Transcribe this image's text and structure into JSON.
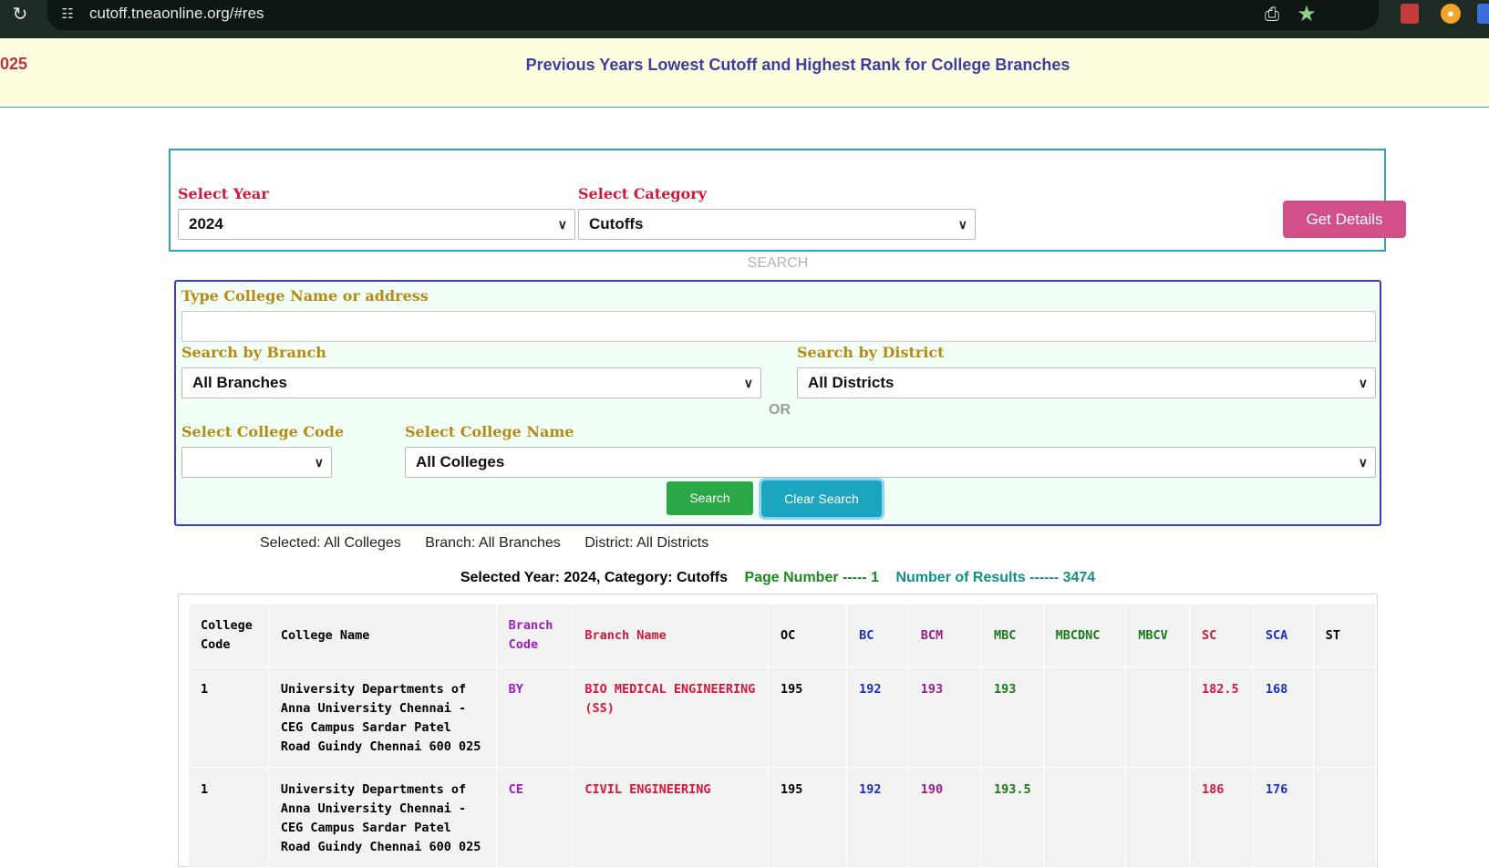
{
  "browser": {
    "url": "cutoff.tneaonline.org/#res"
  },
  "banner": {
    "left_text": "025",
    "title": "Previous Years Lowest Cutoff and Highest Rank for College Branches"
  },
  "filters": {
    "year_label": "Select Year",
    "year_value": "2024",
    "category_label": "Select Category",
    "category_value": "Cutoffs",
    "get_details": "Get Details"
  },
  "search": {
    "caption": "SEARCH",
    "college_text_label": "Type College Name or address",
    "college_text_value": "",
    "branch_label": "Search by Branch",
    "branch_value": "All Branches",
    "district_label": "Search by District",
    "district_value": "All Districts",
    "or_text": "OR",
    "code_label": "Select College Code",
    "code_value": "",
    "name_label": "Select College Name",
    "name_value": "All Colleges",
    "search_button": "Search",
    "clear_button": "Clear Search"
  },
  "selection": {
    "college": "Selected: All Colleges",
    "branch": "Branch: All Branches",
    "district": "District: All Districts"
  },
  "summary": {
    "year_category": "Selected Year: 2024, Category: Cutoffs",
    "page_number": "Page Number ----- 1",
    "results": "Number of Results ------ 3474"
  },
  "table": {
    "headers": {
      "college_code": "College Code",
      "college_name": "College Name",
      "branch_code": "Branch Code",
      "branch_name": "Branch Name",
      "oc": "OC",
      "bc": "BC",
      "bcm": "BCM",
      "mbc": "MBC",
      "mbcdnc": "MBCDNC",
      "mbcv": "MBCV",
      "sc": "SC",
      "sca": "SCA",
      "st": "ST"
    },
    "rows": [
      {
        "college_code": "1",
        "college_name": "University Departments of Anna University Chennai - CEG Campus Sardar Patel Road Guindy Chennai 600 025",
        "branch_code": "BY",
        "branch_name": "BIO MEDICAL ENGINEERING (SS)",
        "oc": "195",
        "bc": "192",
        "bcm": "193",
        "mbc": "193",
        "mbcdnc": "",
        "mbcv": "",
        "sc": "182.5",
        "sca": "168",
        "st": ""
      },
      {
        "college_code": "1",
        "college_name": "University Departments of Anna University Chennai - CEG Campus Sardar Patel Road Guindy Chennai 600 025",
        "branch_code": "CE",
        "branch_name": "CIVIL ENGINEERING",
        "oc": "195",
        "bc": "192",
        "bcm": "190",
        "mbc": "193.5",
        "mbcdnc": "",
        "mbcv": "",
        "sc": "186",
        "sca": "176",
        "st": ""
      }
    ]
  }
}
